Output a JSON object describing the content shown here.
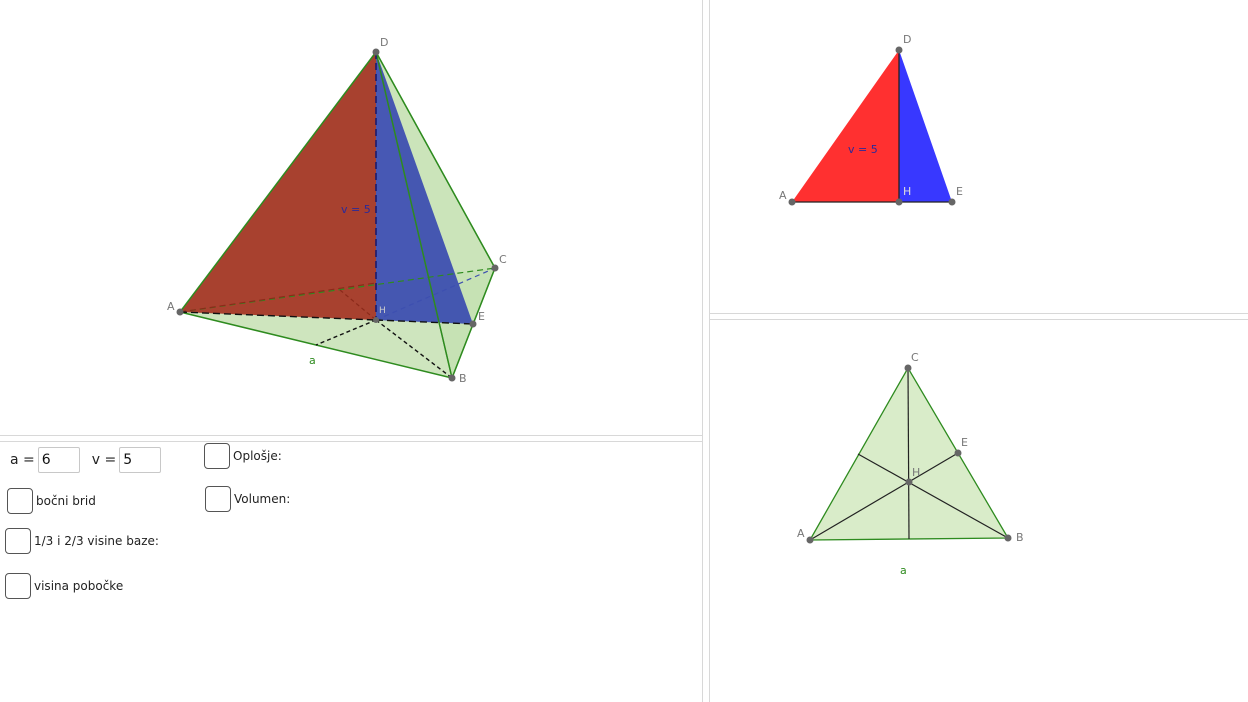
{
  "view3d": {
    "points": {
      "A": "A",
      "B": "B",
      "C": "C",
      "D": "D",
      "E": "E",
      "H": "H"
    },
    "height_label": "v = 5",
    "edge_label": "a"
  },
  "side_view": {
    "points": {
      "A": "A",
      "D": "D",
      "E": "E",
      "H": "H"
    },
    "height_label": "v = 5"
  },
  "base_view": {
    "points": {
      "A": "A",
      "B": "B",
      "C": "C",
      "E": "E",
      "H": "H"
    },
    "edge_label": "a"
  },
  "controls": {
    "a_label": "a =",
    "a_value": "6",
    "v_label": "v =",
    "v_value": "5",
    "checkboxes": {
      "oplosje": "Oplošje:",
      "volumen": "Volumen:",
      "bocni_brid": "bočni brid",
      "visina_baze": "1/3 i 2/3 visine baze:",
      "visina_pobocke": "visina pobočke"
    }
  },
  "colors": {
    "red_face": "#a8412f",
    "blue_face": "#3d4fb0",
    "green_face": "#c5e1b3",
    "green_edge": "#2e8b1f",
    "side_red": "#ff3030",
    "side_blue": "#3838ff",
    "point": "#666666"
  }
}
